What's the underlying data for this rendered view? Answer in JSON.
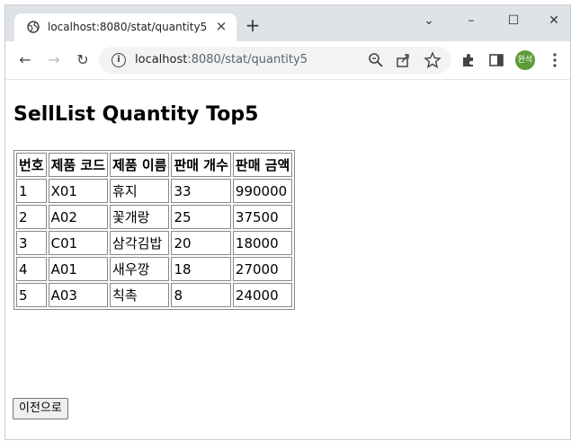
{
  "tab": {
    "title": "localhost:8080/stat/quantity5",
    "close_glyph": "×"
  },
  "new_tab_glyph": "+",
  "window_controls": {
    "dropdown": "⌄",
    "minimize": "–",
    "maximize": "☐",
    "close": "✕"
  },
  "toolbar": {
    "back": "←",
    "forward": "→",
    "reload": "↻",
    "url_host": "localhost",
    "url_path": ":8080/stat/quantity5",
    "avatar_text": "완석"
  },
  "page": {
    "title": "SellList Quantity Top5",
    "table": {
      "headers": [
        "번호",
        "제품 코드",
        "제품 이름",
        "판매 개수",
        "판매 금액"
      ],
      "rows": [
        [
          "1",
          "X01",
          "휴지",
          "33",
          "990000"
        ],
        [
          "2",
          "A02",
          "꽃개랑",
          "25",
          "37500"
        ],
        [
          "3",
          "C01",
          "삼각김밥",
          "20",
          "18000"
        ],
        [
          "4",
          "A01",
          "새우깡",
          "18",
          "27000"
        ],
        [
          "5",
          "A03",
          "칙촉",
          "8",
          "24000"
        ]
      ]
    },
    "back_button": "이전으로"
  },
  "colors": {
    "tabstrip": "#dfe3e8",
    "omnibox": "#f1f3f4",
    "avatar": "#5c9b37"
  }
}
